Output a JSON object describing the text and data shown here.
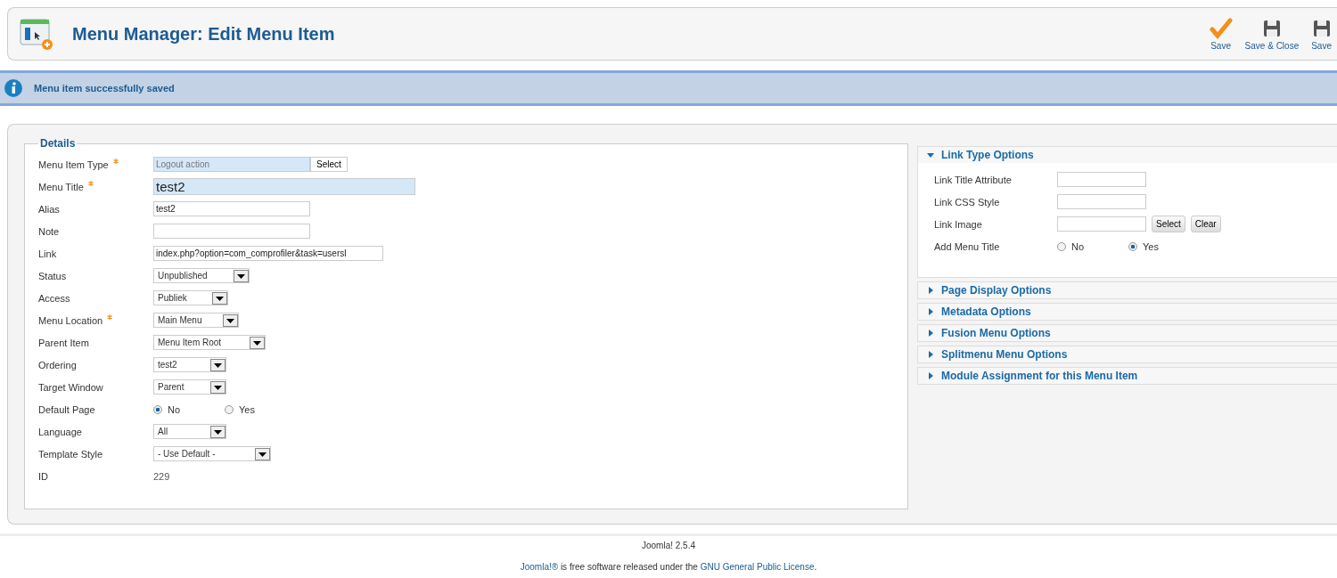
{
  "header": {
    "title": "Menu Manager: Edit Menu Item"
  },
  "toolbar": [
    {
      "kind": "check",
      "label": "Save"
    },
    {
      "kind": "floppy",
      "label": "Save & Close"
    },
    {
      "kind": "floppy",
      "label": "Save"
    }
  ],
  "message": "Menu item successfully saved",
  "details": {
    "legend": "Details",
    "fields": [
      {
        "kind": "picker",
        "label": "Menu Item Type",
        "required": true,
        "value": "Logout action",
        "button": "Select"
      },
      {
        "kind": "title",
        "label": "Menu Title",
        "required": true,
        "value": "test2"
      },
      {
        "kind": "text",
        "label": "Alias",
        "required": false,
        "value": "test2"
      },
      {
        "kind": "text",
        "label": "Note",
        "required": false
      },
      {
        "kind": "wide",
        "label": "Link",
        "required": false,
        "value": "index.php?option=com_comprofiler&task=usersl"
      },
      {
        "kind": "select",
        "label": "Status",
        "required": false,
        "value": "Unpublished"
      },
      {
        "kind": "select",
        "label": "Access",
        "required": false,
        "value": "Publiek"
      },
      {
        "kind": "select",
        "label": "Menu Location",
        "required": true,
        "value": "Main Menu"
      },
      {
        "kind": "select",
        "label": "Parent Item",
        "required": false,
        "value": "Menu Item Root"
      },
      {
        "kind": "select",
        "label": "Ordering",
        "required": false,
        "value": "test2"
      },
      {
        "kind": "select",
        "label": "Target Window",
        "required": false,
        "value": "Parent"
      },
      {
        "kind": "radio",
        "label": "Default Page",
        "required": false,
        "options": [
          {
            "label": "No",
            "selected": true
          },
          {
            "label": "Yes",
            "selected": false
          }
        ]
      },
      {
        "kind": "select",
        "label": "Language",
        "required": false,
        "value": "All"
      },
      {
        "kind": "select",
        "label": "Template Style",
        "required": false,
        "value": "- Use Default -"
      },
      {
        "kind": "static",
        "label": "ID",
        "required": false,
        "value": "229"
      }
    ]
  },
  "panels": [
    {
      "title": "Link Type Options",
      "expanded": true,
      "fields": [
        {
          "kind": "text",
          "label": "Link Title Attribute"
        },
        {
          "kind": "text",
          "label": "Link CSS Style"
        },
        {
          "kind": "image",
          "label": "Link Image",
          "buttons": [
            "Select",
            "Clear"
          ]
        },
        {
          "kind": "radio",
          "label": "Add Menu Title",
          "options": [
            {
              "label": "No",
              "selected": false
            },
            {
              "label": "Yes",
              "selected": true
            }
          ]
        }
      ]
    },
    {
      "title": "Page Display Options",
      "expanded": false
    },
    {
      "title": "Metadata Options",
      "expanded": false
    },
    {
      "title": "Fusion Menu Options",
      "expanded": false
    },
    {
      "title": "Splitmenu Menu Options",
      "expanded": false
    },
    {
      "title": "Module Assignment for this Menu Item",
      "expanded": false
    }
  ],
  "footer": {
    "version": "Joomla! 2.5.4",
    "license": [
      {
        "text": "Joomla!®",
        "link": true
      },
      {
        "text": " is free software released under the ",
        "link": false
      },
      {
        "text": "GNU General Public License",
        "link": true
      },
      {
        "text": ".",
        "link": false
      }
    ]
  }
}
